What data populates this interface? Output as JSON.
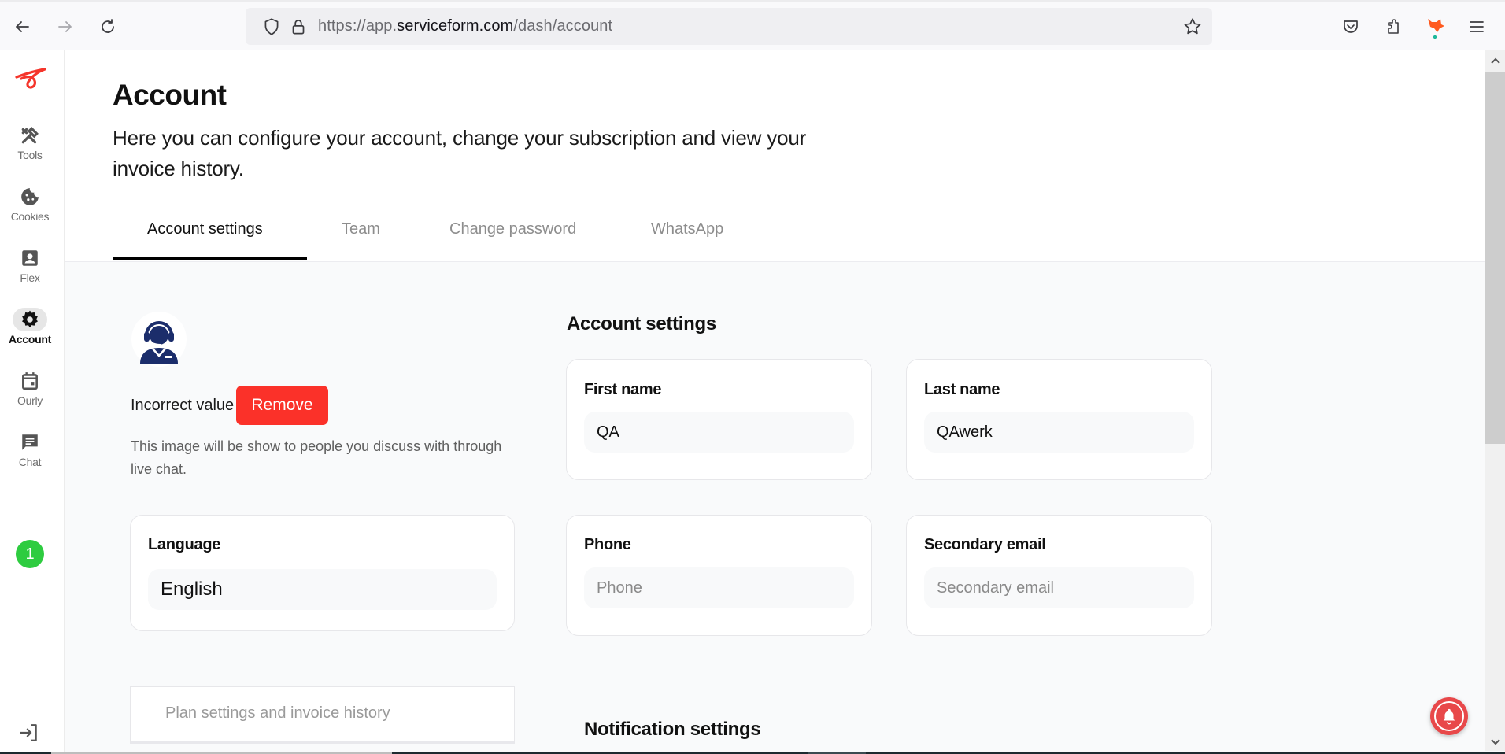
{
  "browser": {
    "url_prefix": "https://app.",
    "url_host": "serviceform.com",
    "url_path": "/dash/account",
    "icons": [
      "back-arrow-icon",
      "forward-arrow-icon",
      "reload-icon",
      "shield-icon",
      "lock-icon",
      "bookmark-star-icon",
      "pocket-icon",
      "extensions-icon",
      "fox-extension-icon",
      "menu-icon"
    ]
  },
  "sidebar": {
    "items": [
      {
        "label": "Tools",
        "icon": "tools-icon",
        "active": false
      },
      {
        "label": "Cookies",
        "icon": "cookie-icon",
        "active": false
      },
      {
        "label": "Flex",
        "icon": "contact-card-icon",
        "active": false
      },
      {
        "label": "Account",
        "icon": "gear-icon",
        "active": true
      },
      {
        "label": "Ourly",
        "icon": "calendar-icon",
        "active": false
      },
      {
        "label": "Chat",
        "icon": "chat-icon",
        "active": false
      }
    ],
    "badge_count": "1",
    "colors": {
      "logo": "#f5352b",
      "badge": "#2ecc40"
    }
  },
  "header": {
    "title": "Account",
    "subtitle": "Here you can configure your account, change your subscription and view your invoice history.",
    "tabs": [
      {
        "label": "Account settings",
        "active": true
      },
      {
        "label": "Team",
        "active": false
      },
      {
        "label": "Change password",
        "active": false
      },
      {
        "label": "WhatsApp",
        "active": false
      }
    ]
  },
  "profile": {
    "avatar_icon": "support-agent-avatar",
    "error_text": "Incorrect value",
    "remove_label": "Remove",
    "help_text": "This image will be show to people you discuss with through live chat.",
    "remove_color": "#fb3129"
  },
  "language": {
    "label": "Language",
    "value": "English"
  },
  "plan_link": "Plan settings and invoice history",
  "account_settings": {
    "heading": "Account settings",
    "fields": {
      "first_name": {
        "label": "First name",
        "value": "QA",
        "placeholder": ""
      },
      "last_name": {
        "label": "Last name",
        "value": "QAwerk",
        "placeholder": ""
      },
      "phone": {
        "label": "Phone",
        "value": "",
        "placeholder": "Phone"
      },
      "secondary_email": {
        "label": "Secondary email",
        "value": "",
        "placeholder": "Secondary email"
      }
    }
  },
  "notification_settings": {
    "heading": "Notification settings"
  },
  "notification_bell_color": "#e8484a"
}
